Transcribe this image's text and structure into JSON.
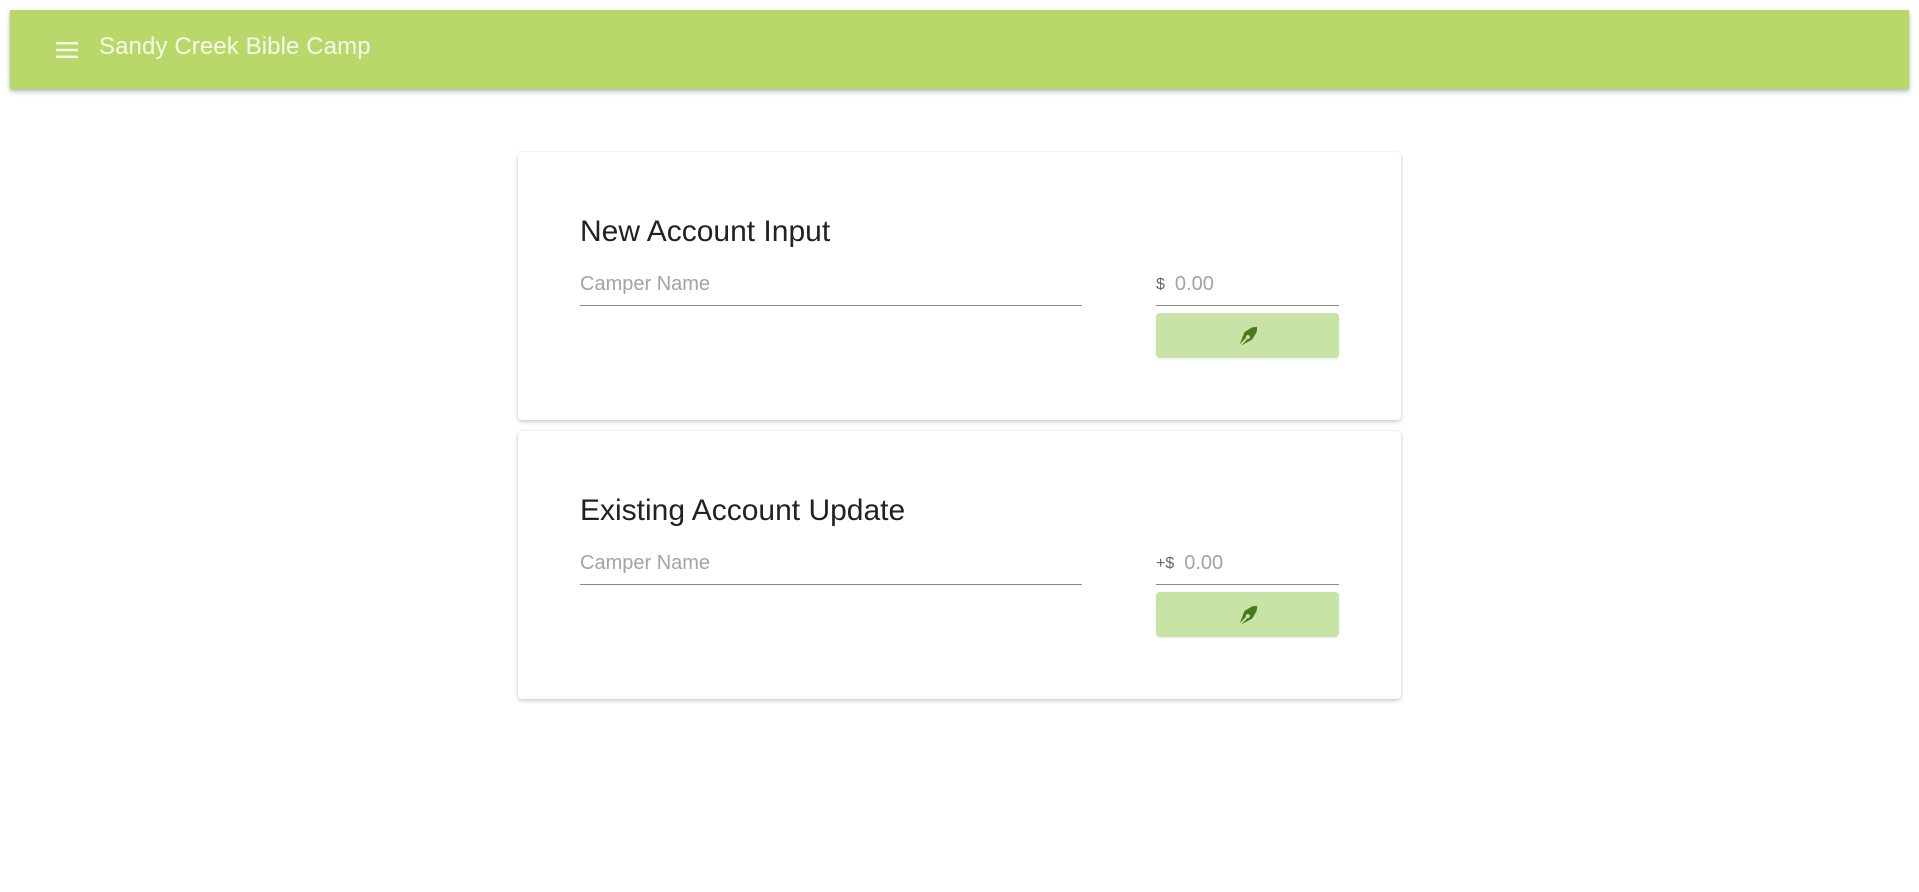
{
  "app": {
    "title": "Sandy Creek Bible Camp",
    "menu_icon": "menu-icon",
    "bar_color": "#b8d86a"
  },
  "new_account": {
    "title": "New Account Input",
    "name_placeholder": "Camper Name",
    "amount_prefix": "$",
    "amount_placeholder": "0.00",
    "submit_icon": "pen-icon"
  },
  "existing_account": {
    "title": "Existing Account Update",
    "name_placeholder": "Camper Name",
    "amount_prefix": "+$",
    "amount_placeholder": "0.00",
    "submit_icon": "pen-icon"
  },
  "colors": {
    "accent": "#b8d86a",
    "button": "#c7e3a5",
    "icon": "#4a7a1c"
  }
}
